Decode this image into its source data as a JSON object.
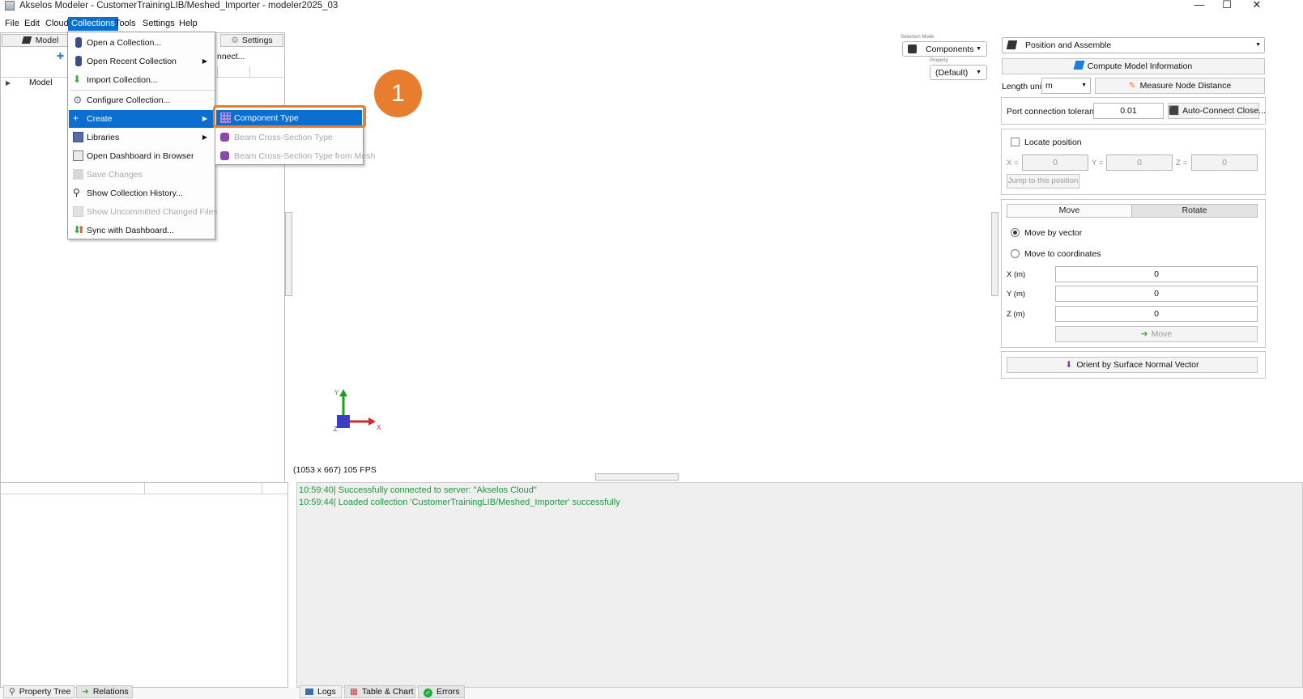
{
  "window": {
    "title": "Akselos Modeler - CustomerTrainingLIB/Meshed_Importer - modeler2025_03",
    "controls": [
      "—",
      "☐",
      "✕"
    ]
  },
  "menubar": {
    "items": [
      "File",
      "Edit",
      "Cloud",
      "Collections",
      "Tools",
      "Settings",
      "Help"
    ],
    "active": "Collections"
  },
  "left_panel": {
    "tabs": [
      "Model",
      "Settings"
    ],
    "connect_label": "nnect...",
    "tree_root": "Model"
  },
  "collections_menu": {
    "items": [
      {
        "label": "Open a Collection...",
        "icon": "database-icon",
        "disabled": false
      },
      {
        "label": "Open Recent Collection",
        "icon": "database-icon",
        "disabled": false,
        "submenu": true
      },
      {
        "label": "Import Collection...",
        "icon": "import-arrow-icon",
        "disabled": false
      },
      {
        "label": "Configure Collection...",
        "icon": "gear-icon",
        "disabled": false
      },
      {
        "label": "Create",
        "icon": "plus-icon",
        "disabled": false,
        "submenu": true,
        "selected": true
      },
      {
        "label": "Libraries",
        "icon": "library-icon",
        "disabled": false,
        "submenu": true
      },
      {
        "label": "Open Dashboard in Browser",
        "icon": "dashboard-icon",
        "disabled": false
      },
      {
        "label": "Save Changes",
        "icon": "save-icon",
        "disabled": true
      },
      {
        "label": "Show Collection History...",
        "icon": "search-icon",
        "disabled": false
      },
      {
        "label": "Show Uncommitted Changed Files",
        "icon": "file-icon",
        "disabled": true
      },
      {
        "label": "Sync with Dashboard...",
        "icon": "sync-icon",
        "disabled": false
      }
    ]
  },
  "create_submenu": {
    "items": [
      {
        "label": "Component Type",
        "icon": "grid-component-icon",
        "disabled": false,
        "selected": true
      },
      {
        "label": "Beam Cross-Section Type",
        "icon": "beam-icon",
        "disabled": true
      },
      {
        "label": "Beam Cross-Section Type from Mesh",
        "icon": "beam-icon",
        "disabled": true
      }
    ]
  },
  "callout": {
    "number": "1",
    "color": "#e87d2e"
  },
  "viewport": {
    "selection_mode_label": "Selection Mode",
    "selection_mode_value": "Components",
    "property_label": "Property",
    "property_value": "(Default)",
    "stats": "(1053 x 667) 105 FPS",
    "axis_labels": {
      "x": "X",
      "y": "Y",
      "z": "Z"
    }
  },
  "right_panel": {
    "mode_dropdown": "Position and Assemble",
    "compute_button": "Compute Model Information",
    "length_unit_label": "Length unit",
    "length_unit_value": "m",
    "measure_button": "Measure Node Distance",
    "port_tolerance_label": "Port connection tolerance",
    "port_tolerance_value": "0.01",
    "auto_connect_button": "Auto-Connect Close...",
    "locate_position_label": "Locate position",
    "locate_x_label": "X =",
    "locate_y_label": "Y =",
    "locate_z_label": "Z =",
    "locate_x": "0",
    "locate_y": "0",
    "locate_z": "0",
    "jump_button": "Jump to this position",
    "tabs": [
      "Move",
      "Rotate"
    ],
    "move_by_vector": "Move by vector",
    "move_to_coordinates": "Move to coordinates",
    "x_label": "X (m)",
    "y_label": "Y (m)",
    "z_label": "Z (m)",
    "x_value": "0",
    "y_value": "0",
    "z_value": "0",
    "move_button": "Move",
    "orient_button": "Orient by Surface Normal Vector"
  },
  "logs": [
    "10:59:40| Successfully connected to server: \"Akselos Cloud\"",
    "10:59:44| Loaded collection 'CustomerTrainingLIB/Meshed_Importer' successfully"
  ],
  "bottom_tabs_left": [
    "Property Tree",
    "Relations"
  ],
  "bottom_tabs_right": [
    "Logs",
    "Table & Chart",
    "Errors"
  ]
}
